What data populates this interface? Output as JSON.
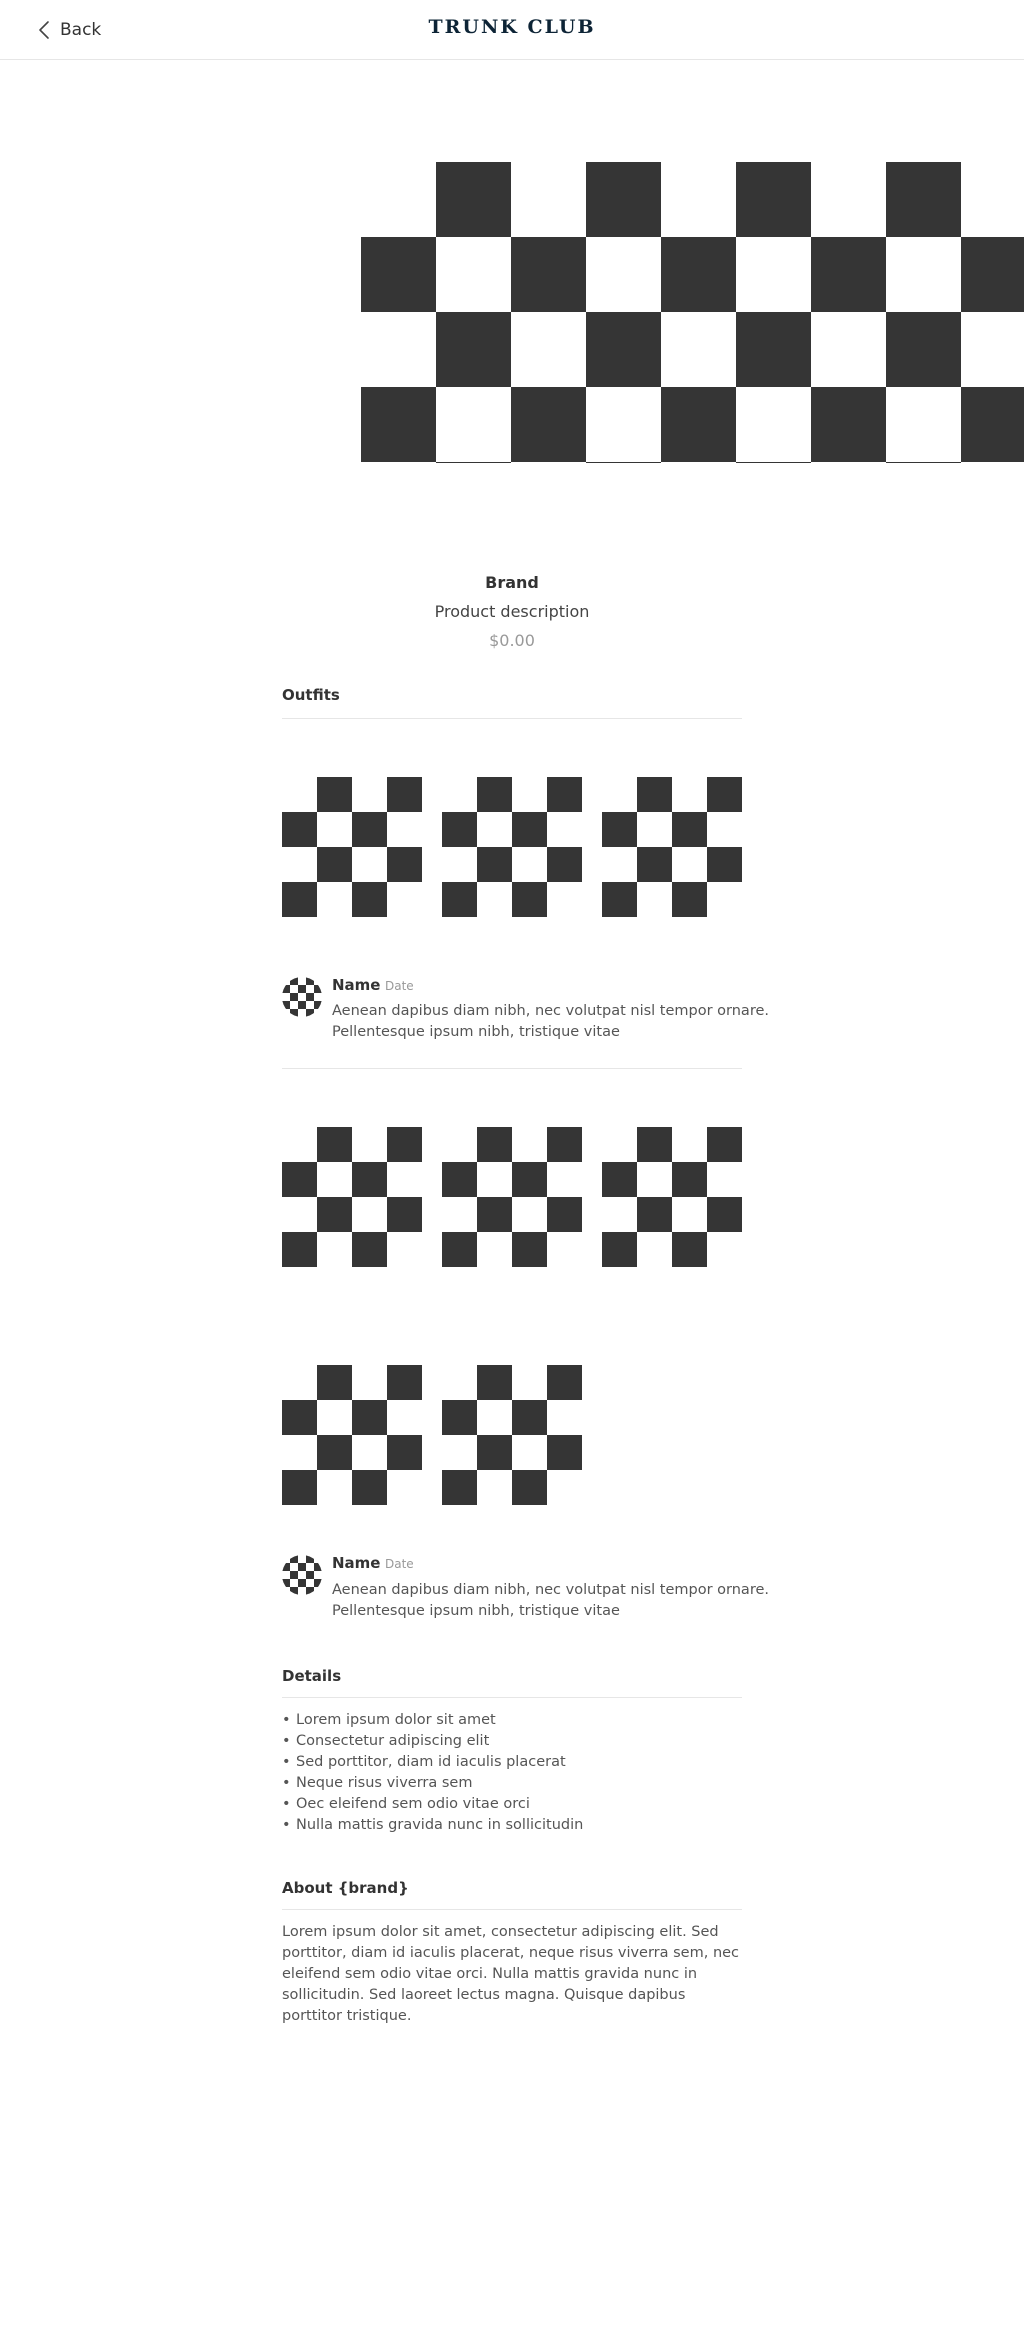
{
  "header": {
    "back_label": "Back",
    "logo_text": "TRUNK CLUB"
  },
  "product": {
    "brand": "Brand",
    "description": "Product description",
    "price": "$0.00"
  },
  "outfits": {
    "title": "Outfits",
    "groups": [
      {
        "review": {
          "name": "Name",
          "date": "Date",
          "text": "Aenean dapibus diam nibh, nec volutpat nisl tempor ornare. Pellentesque ipsum nibh, tristique vitae"
        }
      },
      {
        "review": {
          "name": "Name",
          "date": "Date",
          "text": "Aenean dapibus diam nibh, nec volutpat nisl tempor ornare. Pellentesque ipsum nibh, tristique vitae"
        }
      }
    ]
  },
  "details": {
    "title": "Details",
    "items": [
      "Lorem ipsum dolor sit amet",
      "Consectetur adipiscing elit",
      "Sed porttitor, diam id iaculis placerat",
      "Neque risus viverra sem",
      "Oec eleifend sem odio vitae orci",
      "Nulla mattis gravida nunc in sollicitudin"
    ]
  },
  "about": {
    "title": "About {brand}",
    "text": "Lorem ipsum dolor sit amet, consectetur adipiscing elit. Sed porttitor, diam id iaculis placerat, neque risus viverra sem, nec eleifend sem odio vitae orci. Nulla mattis gravida nunc in sollicitudin. Sed laoreet lectus magna. Quisque dapibus porttitor tristique."
  },
  "colors": {
    "placeholder_dark": "#353535",
    "logo": "#0d2436",
    "divider": "#e6e6e6"
  },
  "icons": {
    "back": "chevron-left-icon"
  }
}
